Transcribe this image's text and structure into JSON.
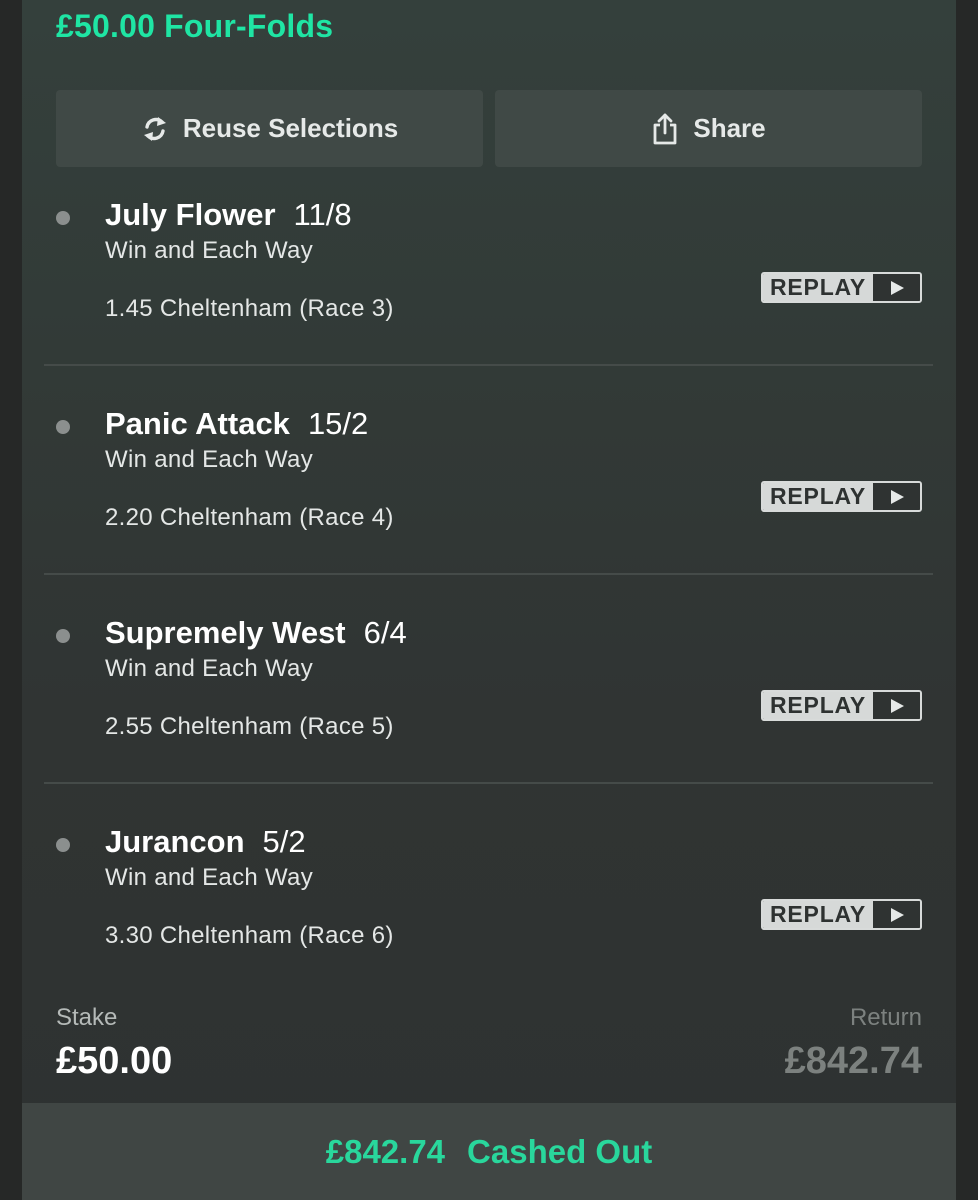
{
  "bet": {
    "title": "£50.00 Four-Folds"
  },
  "actions": {
    "reuse_label": "Reuse Selections",
    "reuse_icon": "refresh-icon",
    "share_label": "Share",
    "share_icon": "share-icon"
  },
  "selections": [
    {
      "name": "July Flower",
      "odds": "11/8",
      "market": "Win and Each Way",
      "race": "1.45 Cheltenham (Race 3)",
      "replay_label": "REPLAY"
    },
    {
      "name": "Panic Attack",
      "odds": "15/2",
      "market": "Win and Each Way",
      "race": "2.20 Cheltenham (Race 4)",
      "replay_label": "REPLAY"
    },
    {
      "name": "Supremely West",
      "odds": "6/4",
      "market": "Win and Each Way",
      "race": "2.55 Cheltenham (Race 5)",
      "replay_label": "REPLAY"
    },
    {
      "name": "Jurancon",
      "odds": "5/2",
      "market": "Win and Each Way",
      "race": "3.30 Cheltenham (Race 6)",
      "replay_label": "REPLAY"
    }
  ],
  "summary": {
    "stake_label": "Stake",
    "stake_value": "£50.00",
    "return_label": "Return",
    "return_value": "£842.74"
  },
  "cashout": {
    "amount": "£842.74",
    "status": "Cashed Out"
  },
  "colors": {
    "accent": "#1fe5a4",
    "cashout": "#29d79c",
    "background": "#2a2c2b"
  }
}
